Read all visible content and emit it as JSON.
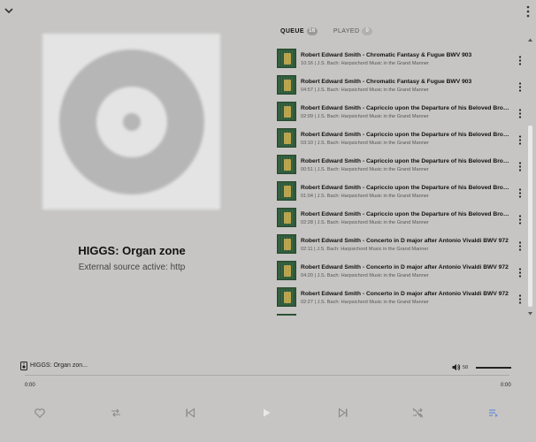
{
  "top": {
    "chevron_icon": "chevron-down-icon",
    "menu_icon": "more-vert-icon"
  },
  "now_playing": {
    "title": "HIGGS: Organ zone",
    "subtitle": "External source active: http",
    "art_icon": "disc-placeholder-icon"
  },
  "tabs": [
    {
      "label": "QUEUE",
      "count": "16",
      "active": true
    },
    {
      "label": "PLAYED",
      "count": "0",
      "active": false
    }
  ],
  "queue": [
    {
      "title": "Robert Edward Smith - Chromatic Fantasy & Fugue BWV 903",
      "duration": "10:16",
      "album": "J.S. Bach: Harpsichord Music in the Grand Manner"
    },
    {
      "title": "Robert Edward Smith - Chromatic Fantasy & Fugue BWV 903",
      "duration": "04:57",
      "album": "J.S. Bach: Harpsichord Music in the Grand Manner"
    },
    {
      "title": "Robert Edward Smith - Capriccio upon the Departure of his Beloved Brother B...",
      "duration": "02:09",
      "album": "J.S. Bach: Harpsichord Music in the Grand Manner"
    },
    {
      "title": "Robert Edward Smith - Capriccio upon the Departure of his Beloved Brother B...",
      "duration": "03:10",
      "album": "J.S. Bach: Harpsichord Music in the Grand Manner"
    },
    {
      "title": "Robert Edward Smith - Capriccio upon the Departure of his Beloved Brother B...",
      "duration": "00:51",
      "album": "J.S. Bach: Harpsichord Music in the Grand Manner"
    },
    {
      "title": "Robert Edward Smith - Capriccio upon the Departure of his Beloved Brother B...",
      "duration": "01:04",
      "album": "J.S. Bach: Harpsichord Music in the Grand Manner"
    },
    {
      "title": "Robert Edward Smith - Capriccio upon the Departure of his Beloved Brother B...",
      "duration": "02:28",
      "album": "J.S. Bach: Harpsichord Music in the Grand Manner"
    },
    {
      "title": "Robert Edward Smith - Concerto in D major after Antonio Vivaldi BWV 972",
      "duration": "02:11",
      "album": "J.S. Bach: Harpsichord Music in the Grand Manner"
    },
    {
      "title": "Robert Edward Smith - Concerto in D major after Antonio Vivaldi BWV 972",
      "duration": "04:20",
      "album": "J.S. Bach: Harpsichord Music in the Grand Manner"
    },
    {
      "title": "Robert Edward Smith - Concerto in D major after Antonio Vivaldi BWV 972",
      "duration": "02:27",
      "album": "J.S. Bach: Harpsichord Music in the Grand Manner"
    },
    {
      "title": "",
      "duration": "",
      "album": ""
    }
  ],
  "player": {
    "mini_label": "HIGGS: Organ zon...",
    "volume": "58",
    "time_elapsed": "0:00",
    "time_total": "0:00",
    "buttons": {
      "favorite": "heart-icon",
      "repeat": "repeat-icon",
      "previous": "skip-previous-icon",
      "play": "play-icon",
      "next": "skip-next-icon",
      "shuffle": "shuffle-off-icon",
      "queue": "queue-list-icon"
    },
    "accent": "#6b8fd6"
  }
}
